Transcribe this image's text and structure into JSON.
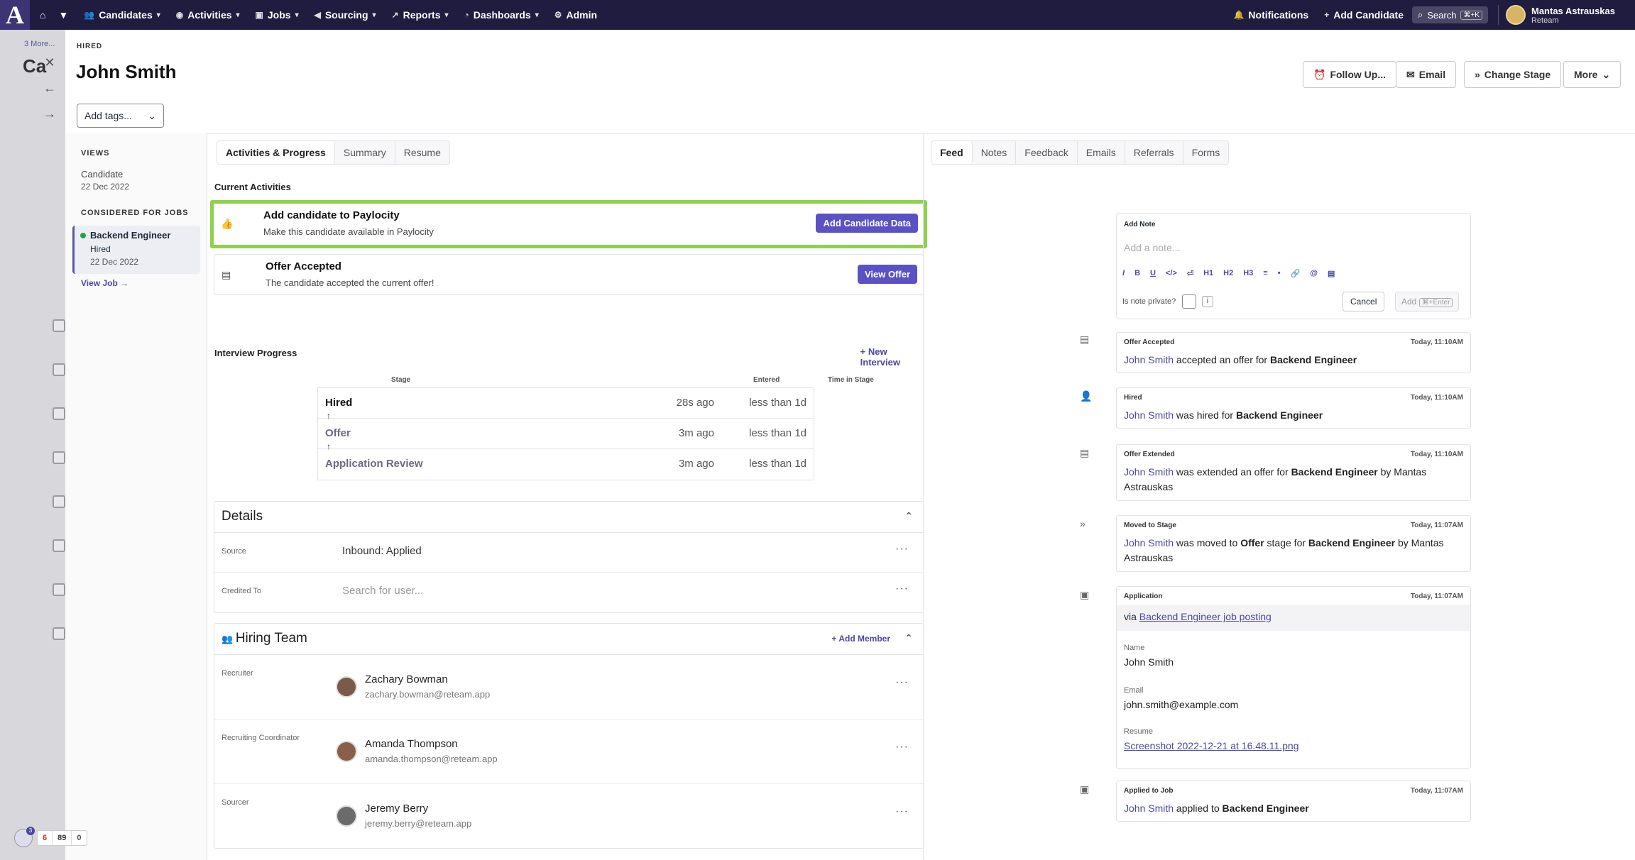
{
  "nav": {
    "items": [
      {
        "label": "Candidates",
        "icon": "users-icon"
      },
      {
        "label": "Activities",
        "icon": "check-circle-icon"
      },
      {
        "label": "Jobs",
        "icon": "briefcase-icon"
      },
      {
        "label": "Sourcing",
        "icon": "megaphone-icon"
      },
      {
        "label": "Reports",
        "icon": "chart-line-icon"
      },
      {
        "label": "Dashboards",
        "icon": "gauge-icon"
      }
    ],
    "admin": "Admin",
    "notifications": "Notifications",
    "add_candidate": "Add Candidate",
    "search": "Search",
    "search_kbd": "⌘+K",
    "user_name": "Mantas Astrauskas",
    "user_org": "Reteam"
  },
  "bg": {
    "crumb": "3 More...",
    "title": "Ca"
  },
  "candidate": {
    "stage_label": "HIRED",
    "name": "John Smith",
    "tags_placeholder": "Add tags..."
  },
  "header_buttons": {
    "follow_up": "Follow Up...",
    "email": "Email",
    "change_stage": "Change Stage",
    "more": "More"
  },
  "views": {
    "views_title": "VIEWS",
    "candidate": "Candidate",
    "candidate_date": "22 Dec 2022",
    "considered_title": "CONSIDERED FOR JOBS",
    "job_title": "Backend Engineer",
    "job_stage": "Hired",
    "job_date": "22 Dec 2022",
    "view_job": "View Job →"
  },
  "mid_tabs": [
    "Activities & Progress",
    "Summary",
    "Resume"
  ],
  "current_activities": {
    "title": "Current Activities",
    "items": [
      {
        "title": "Add candidate to Paylocity",
        "desc": "Make this candidate available in Paylocity",
        "button": "Add Candidate Data"
      },
      {
        "title": "Offer Accepted",
        "desc": "The candidate accepted the current offer!",
        "button": "View Offer"
      }
    ]
  },
  "interview": {
    "title": "Interview Progress",
    "new_interview": "+ New Interview",
    "headers": {
      "stage": "Stage",
      "entered": "Entered",
      "time": "Time in Stage"
    },
    "rows": [
      {
        "stage": "Hired",
        "entered": "28s ago",
        "time": "less than 1d"
      },
      {
        "stage": "Offer",
        "entered": "3m ago",
        "time": "less than 1d"
      },
      {
        "stage": "Application Review",
        "entered": "3m ago",
        "time": "less than 1d"
      }
    ]
  },
  "details": {
    "title": "Details",
    "rows": [
      {
        "label": "Source",
        "value": "Inbound: Applied"
      },
      {
        "label": "Credited To",
        "value": "Search for user..."
      }
    ]
  },
  "hiring_team": {
    "title": "Hiring Team",
    "add_member": "+ Add Member",
    "members": [
      {
        "role": "Recruiter",
        "name": "Zachary Bowman",
        "email": "zachary.bowman@reteam.app"
      },
      {
        "role": "Recruiting Coordinator",
        "name": "Amanda Thompson",
        "email": "amanda.thompson@reteam.app"
      },
      {
        "role": "Sourcer",
        "name": "Jeremy Berry",
        "email": "jeremy.berry@reteam.app"
      }
    ]
  },
  "right_tabs": [
    "Feed",
    "Notes",
    "Feedback",
    "Emails",
    "Referrals",
    "Forms"
  ],
  "note": {
    "label": "Add Note",
    "placeholder": "Add a note...",
    "toolbar": [
      "I",
      "B",
      "U",
      "</>",
      "⏎",
      "H1",
      "H2",
      "H3",
      "≡",
      "•",
      "🔗",
      "@",
      "▤"
    ],
    "private": "Is note private?",
    "cancel": "Cancel",
    "add": "Add",
    "add_kbd": "⌘+Enter"
  },
  "feed": {
    "offer_accepted": {
      "label": "Offer Accepted",
      "time": "Today, 11:10AM",
      "who": "John Smith",
      "text": " accepted an offer for ",
      "job": "Backend Engineer"
    },
    "hired": {
      "label": "Hired",
      "time": "Today, 11:10AM",
      "who": "John Smith",
      "text": " was hired for ",
      "job": "Backend Engineer"
    },
    "offer_extended": {
      "label": "Offer Extended",
      "time": "Today, 11:10AM",
      "who": "John Smith",
      "text": " was extended an offer for ",
      "job": "Backend Engineer",
      "by": " by Mantas Astrauskas"
    },
    "moved": {
      "label": "Moved to Stage",
      "time": "Today, 11:07AM",
      "who": "John Smith",
      "text1": " was moved to ",
      "stage": "Offer",
      "text2": " stage for ",
      "job": "Backend Engineer",
      "by": " by Mantas Astrauskas"
    },
    "application": {
      "label": "Application",
      "time": "Today, 11:07AM",
      "via": "via ",
      "via_link": "Backend Engineer job posting",
      "name_lbl": "Name",
      "name": "John Smith",
      "email_lbl": "Email",
      "email": "john.smith@example.com",
      "resume_lbl": "Resume",
      "resume": "Screenshot 2022-12-21 at 16.48.11.png"
    },
    "applied": {
      "label": "Applied to Job",
      "time": "Today, 11:07AM",
      "who": "John Smith",
      "text": " applied to ",
      "job": "Backend Engineer"
    }
  },
  "status_counts": [
    "6",
    "89",
    "0"
  ],
  "help_badge": "3"
}
